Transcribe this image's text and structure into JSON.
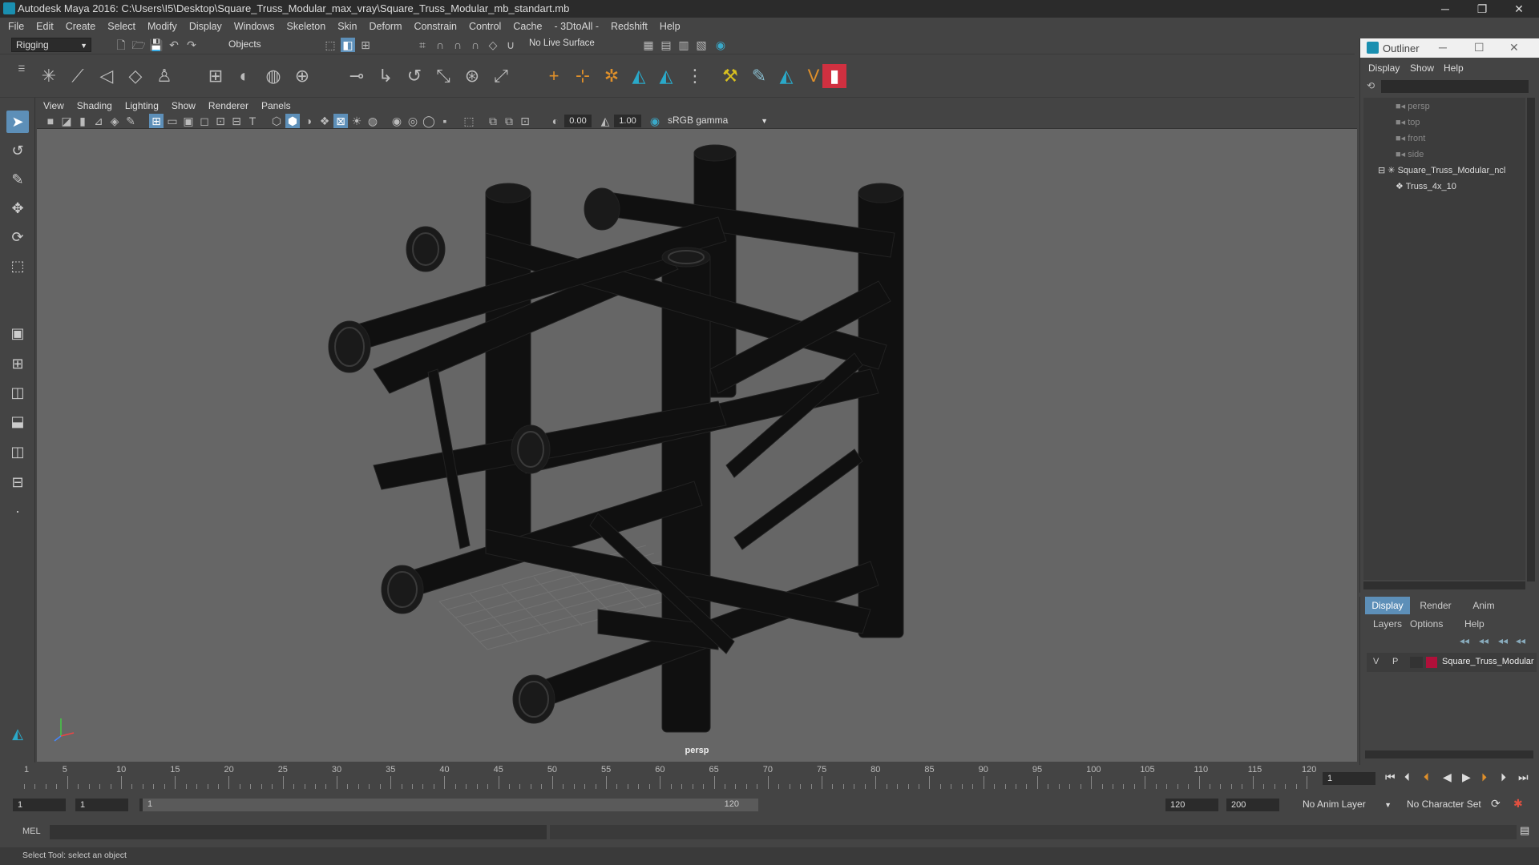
{
  "window": {
    "title": "Autodesk Maya 2016: C:\\Users\\I5\\Desktop\\Square_Truss_Modular_max_vray\\Square_Truss_Modular_mb_standart.mb",
    "minimize": "─",
    "maximize": "❐",
    "close": "✕"
  },
  "menubar": [
    "File",
    "Edit",
    "Create",
    "Select",
    "Modify",
    "Display",
    "Windows",
    "Skeleton",
    "Skin",
    "Deform",
    "Constrain",
    "Control",
    "Cache",
    "- 3DtoAll -",
    "Redshift",
    "Help"
  ],
  "statusline": {
    "menuset": "Rigging",
    "selection_mode": "Objects",
    "live_surface": "No Live Surface"
  },
  "panel": {
    "menu": [
      "View",
      "Shading",
      "Lighting",
      "Show",
      "Renderer",
      "Panels"
    ],
    "exposure": "0.00",
    "gamma": "1.00",
    "colorspace": "sRGB gamma",
    "camera": "persp"
  },
  "outliner": {
    "title": "Outliner",
    "menu": [
      "Display",
      "Show",
      "Help"
    ],
    "items": [
      {
        "label": "persp"
      },
      {
        "label": "top"
      },
      {
        "label": "front"
      },
      {
        "label": "side"
      },
      {
        "label": "Square_Truss_Modular_ncl"
      },
      {
        "label": "Truss_4x_10"
      }
    ]
  },
  "layers": {
    "tabs": [
      "Display",
      "Render",
      "Anim"
    ],
    "menu": [
      "Layers",
      "Options",
      "Help"
    ],
    "layer": {
      "v": "V",
      "p": "P",
      "name": "Square_Truss_Modular",
      "color": "#b0103a"
    }
  },
  "timeline": {
    "ticks": [
      "5",
      "10",
      "15",
      "20",
      "25",
      "30",
      "35",
      "40",
      "45",
      "50",
      "55",
      "60",
      "65",
      "70",
      "75",
      "80",
      "85",
      "90",
      "95",
      "100",
      "105",
      "110",
      "115",
      "120"
    ],
    "start_marker": "1",
    "current_frame": "1"
  },
  "range": {
    "start": "1",
    "playback_start": "1",
    "slider_start": "1",
    "slider_end": "120",
    "playback_end": "120",
    "end": "200",
    "anim_layer": "No Anim Layer",
    "character_set": "No Character Set"
  },
  "cmdline": {
    "label": "MEL"
  },
  "helpline": {
    "text": "Select Tool: select an object"
  }
}
